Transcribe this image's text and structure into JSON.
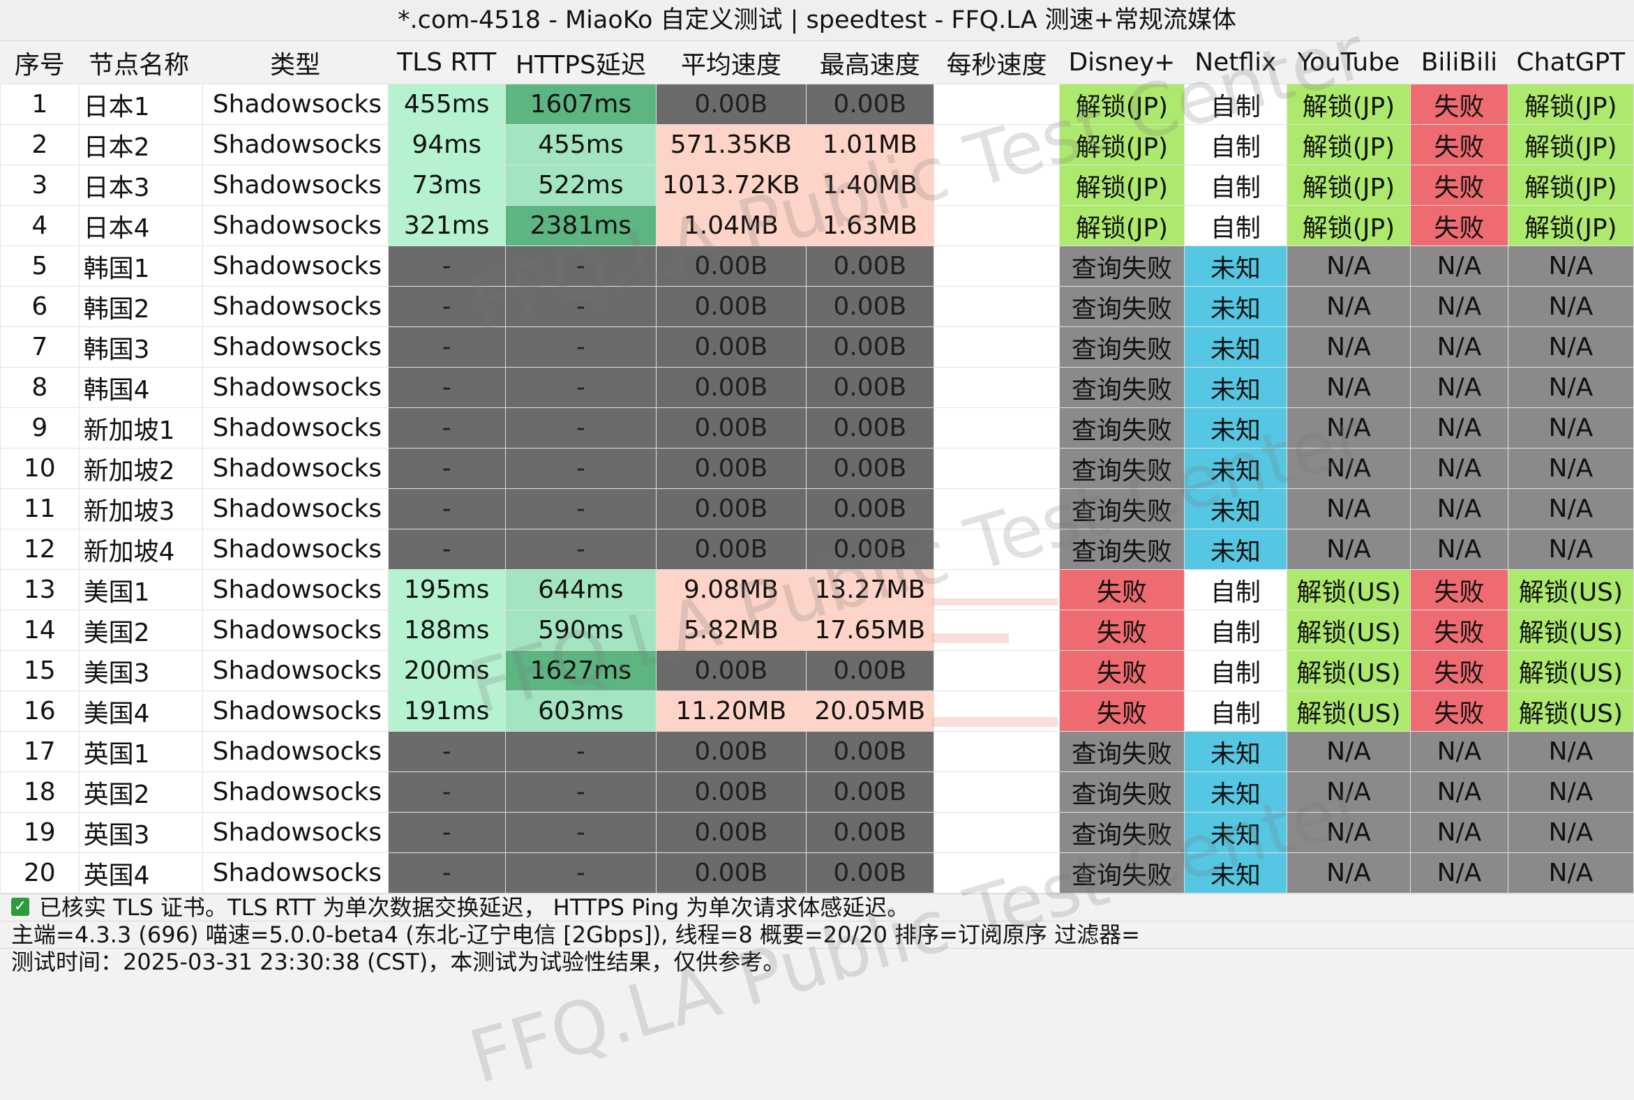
{
  "title": "*.com-4518 - MiaoKo 自定义测试 | speedtest - FFQ.LA 测速+常规流媒体",
  "columns": [
    "序号",
    "节点名称",
    "类型",
    "TLS RTT",
    "HTTPS延迟",
    "平均速度",
    "最高速度",
    "每秒速度",
    "Disney+",
    "Netflix",
    "YouTube",
    "BiliBili",
    "ChatGPT"
  ],
  "rows": [
    [
      "1",
      "日本1",
      "Shadowsocks",
      "455ms",
      "1607ms",
      "0.00B",
      "0.00B",
      "",
      "解锁(JP)",
      "自制",
      "解锁(JP)",
      "失败",
      "解锁(JP)"
    ],
    [
      "2",
      "日本2",
      "Shadowsocks",
      "94ms",
      "455ms",
      "571.35KB",
      "1.01MB",
      "",
      "解锁(JP)",
      "自制",
      "解锁(JP)",
      "失败",
      "解锁(JP)"
    ],
    [
      "3",
      "日本3",
      "Shadowsocks",
      "73ms",
      "522ms",
      "1013.72KB",
      "1.40MB",
      "",
      "解锁(JP)",
      "自制",
      "解锁(JP)",
      "失败",
      "解锁(JP)"
    ],
    [
      "4",
      "日本4",
      "Shadowsocks",
      "321ms",
      "2381ms",
      "1.04MB",
      "1.63MB",
      "",
      "解锁(JP)",
      "自制",
      "解锁(JP)",
      "失败",
      "解锁(JP)"
    ],
    [
      "5",
      "韩国1",
      "Shadowsocks",
      "-",
      "-",
      "0.00B",
      "0.00B",
      "",
      "查询失败",
      "未知",
      "N/A",
      "N/A",
      "N/A"
    ],
    [
      "6",
      "韩国2",
      "Shadowsocks",
      "-",
      "-",
      "0.00B",
      "0.00B",
      "",
      "查询失败",
      "未知",
      "N/A",
      "N/A",
      "N/A"
    ],
    [
      "7",
      "韩国3",
      "Shadowsocks",
      "-",
      "-",
      "0.00B",
      "0.00B",
      "",
      "查询失败",
      "未知",
      "N/A",
      "N/A",
      "N/A"
    ],
    [
      "8",
      "韩国4",
      "Shadowsocks",
      "-",
      "-",
      "0.00B",
      "0.00B",
      "",
      "查询失败",
      "未知",
      "N/A",
      "N/A",
      "N/A"
    ],
    [
      "9",
      "新加坡1",
      "Shadowsocks",
      "-",
      "-",
      "0.00B",
      "0.00B",
      "",
      "查询失败",
      "未知",
      "N/A",
      "N/A",
      "N/A"
    ],
    [
      "10",
      "新加坡2",
      "Shadowsocks",
      "-",
      "-",
      "0.00B",
      "0.00B",
      "",
      "查询失败",
      "未知",
      "N/A",
      "N/A",
      "N/A"
    ],
    [
      "11",
      "新加坡3",
      "Shadowsocks",
      "-",
      "-",
      "0.00B",
      "0.00B",
      "",
      "查询失败",
      "未知",
      "N/A",
      "N/A",
      "N/A"
    ],
    [
      "12",
      "新加坡4",
      "Shadowsocks",
      "-",
      "-",
      "0.00B",
      "0.00B",
      "",
      "查询失败",
      "未知",
      "N/A",
      "N/A",
      "N/A"
    ],
    [
      "13",
      "美国1",
      "Shadowsocks",
      "195ms",
      "644ms",
      "9.08MB",
      "13.27MB",
      "",
      "失败",
      "自制",
      "解锁(US)",
      "失败",
      "解锁(US)"
    ],
    [
      "14",
      "美国2",
      "Shadowsocks",
      "188ms",
      "590ms",
      "5.82MB",
      "17.65MB",
      "",
      "失败",
      "自制",
      "解锁(US)",
      "失败",
      "解锁(US)"
    ],
    [
      "15",
      "美国3",
      "Shadowsocks",
      "200ms",
      "1627ms",
      "0.00B",
      "0.00B",
      "",
      "失败",
      "自制",
      "解锁(US)",
      "失败",
      "解锁(US)"
    ],
    [
      "16",
      "美国4",
      "Shadowsocks",
      "191ms",
      "603ms",
      "11.20MB",
      "20.05MB",
      "",
      "失败",
      "自制",
      "解锁(US)",
      "失败",
      "解锁(US)"
    ],
    [
      "17",
      "英国1",
      "Shadowsocks",
      "-",
      "-",
      "0.00B",
      "0.00B",
      "",
      "查询失败",
      "未知",
      "N/A",
      "N/A",
      "N/A"
    ],
    [
      "18",
      "英国2",
      "Shadowsocks",
      "-",
      "-",
      "0.00B",
      "0.00B",
      "",
      "查询失败",
      "未知",
      "N/A",
      "N/A",
      "N/A"
    ],
    [
      "19",
      "英国3",
      "Shadowsocks",
      "-",
      "-",
      "0.00B",
      "0.00B",
      "",
      "查询失败",
      "未知",
      "N/A",
      "N/A",
      "N/A"
    ],
    [
      "20",
      "英国4",
      "Shadowsocks",
      "-",
      "-",
      "0.00B",
      "0.00B",
      "",
      "查询失败",
      "未知",
      "N/A",
      "N/A",
      "N/A"
    ]
  ],
  "footer": {
    "tls_note": "已核实 TLS 证书。TLS RTT 为单次数据交换延迟， HTTPS Ping 为单次请求体感延迟。",
    "info": "主端=4.3.3 (696) 喵速=5.0.0-beta4 (东北-辽宁电信 [2Gbps]), 线程=8 概要=20/20 排序=订阅原序 过滤器=",
    "time": "测试时间：2025-03-31 23:30:38 (CST)，本测试为试验性结果，仅供参考。"
  },
  "watermark": "FFQ.LA Public Test Center",
  "colors": {
    "rtt": "#b4f2d0",
    "https_light": "#a2e5c0",
    "https_dark": "#5db582",
    "speed": "#fdd4c7",
    "gray": "#6b6b6b",
    "unlock": "#ade96c",
    "fail": "#ee6b72",
    "unknown": "#55c7e2",
    "na": "#8a8a8a"
  }
}
